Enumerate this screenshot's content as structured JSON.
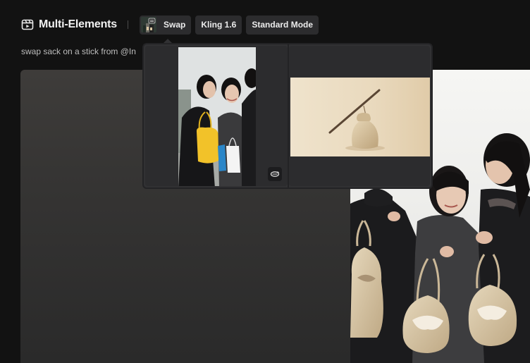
{
  "header": {
    "title": "Multi-Elements",
    "icon": "clapper-icon",
    "chips": [
      {
        "label": "Swap",
        "thumb_icon": "swap-thumbnail"
      },
      {
        "label": "Kling 1.6"
      },
      {
        "label": "Standard Mode"
      }
    ]
  },
  "prompt": {
    "text": "swap sack on a stick from @In"
  },
  "popover": {
    "badge_icon": "swap-icon"
  },
  "colors": {
    "background": "#121212",
    "chip": "#2c2c2e",
    "popover": "#313133",
    "bag_yellow": "#f2c229",
    "sack_beige": "#d8c6a3"
  }
}
